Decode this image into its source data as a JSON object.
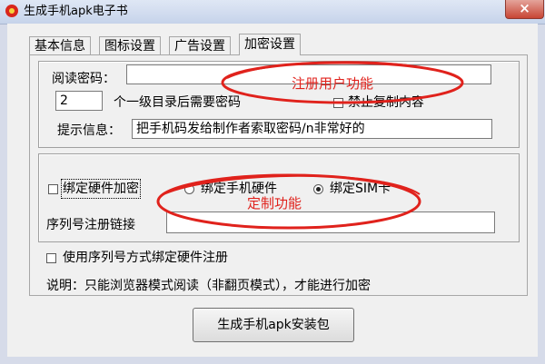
{
  "window": {
    "title": "生成手机apk电子书",
    "close_label": "×"
  },
  "tabs": [
    {
      "label": "基本信息",
      "active": false
    },
    {
      "label": "图标设置",
      "active": false
    },
    {
      "label": "广告设置",
      "active": false
    },
    {
      "label": "加密设置",
      "active": true
    }
  ],
  "registration": {
    "password_label": "阅读密码：",
    "password_value": "",
    "level_value": "2",
    "level_suffix": "个一级目录后需要密码",
    "disable_copy_label": "禁止复制内容",
    "disable_copy_checked": false,
    "hint_label": "提示信息：",
    "hint_value": "把手机码发给制作者索取密码/n非常好的"
  },
  "hardware": {
    "bind_label": "绑定硬件加密",
    "bind_checked": false,
    "radio_phone_label": "绑定手机硬件",
    "radio_sim_label": "绑定SIM卡",
    "selected": "sim",
    "serial_link_label": "序列号注册链接",
    "serial_link_value": ""
  },
  "serial_bind": {
    "label": "使用序列号方式绑定硬件注册",
    "checked": false
  },
  "note": "说明：只能浏览器模式阅读（非翻页模式），才能进行加密",
  "generate_button": "生成手机apk安装包",
  "annotations": {
    "top": "注册用户功能",
    "bottom": "定制功能",
    "color": "#e0221c"
  }
}
